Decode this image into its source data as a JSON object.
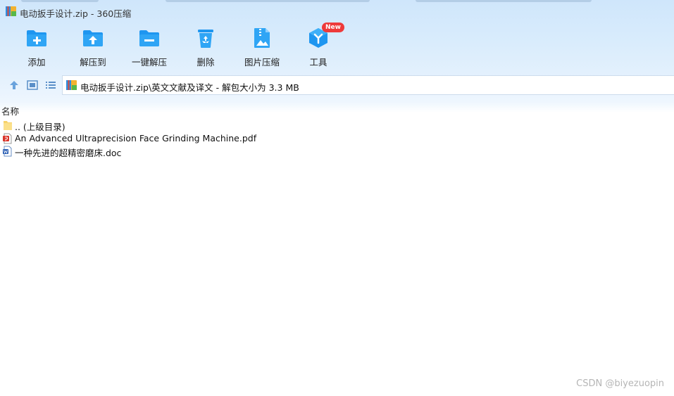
{
  "window": {
    "title": "电动扳手设计.zip - 360压缩"
  },
  "toolbar": {
    "items": [
      {
        "label": "添加",
        "icon": "add-folder-icon"
      },
      {
        "label": "解压到",
        "icon": "extract-to-icon"
      },
      {
        "label": "一键解压",
        "icon": "one-click-extract-icon"
      },
      {
        "label": "删除",
        "icon": "recycle-bin-icon"
      },
      {
        "label": "图片压缩",
        "icon": "image-compress-icon"
      },
      {
        "label": "工具",
        "icon": "tools-icon",
        "badge": "New"
      }
    ]
  },
  "navbar": {
    "path": "电动扳手设计.zip\\英文文献及译文 - 解包大小为 3.3 MB"
  },
  "file_list": {
    "column_name": "名称",
    "rows": [
      {
        "name": ".. (上级目录)",
        "icon": "folder-icon"
      },
      {
        "name": "An Advanced Ultraprecision Face Grinding Machine.pdf",
        "icon": "pdf-file-icon"
      },
      {
        "name": "一种先进的超精密磨床.doc",
        "icon": "word-file-icon"
      }
    ]
  },
  "watermark": "CSDN @biyezuopin",
  "colors": {
    "accent": "#1e96f0",
    "badge": "#ee3a3a",
    "toolbar_bg": "#d9ecfc"
  }
}
